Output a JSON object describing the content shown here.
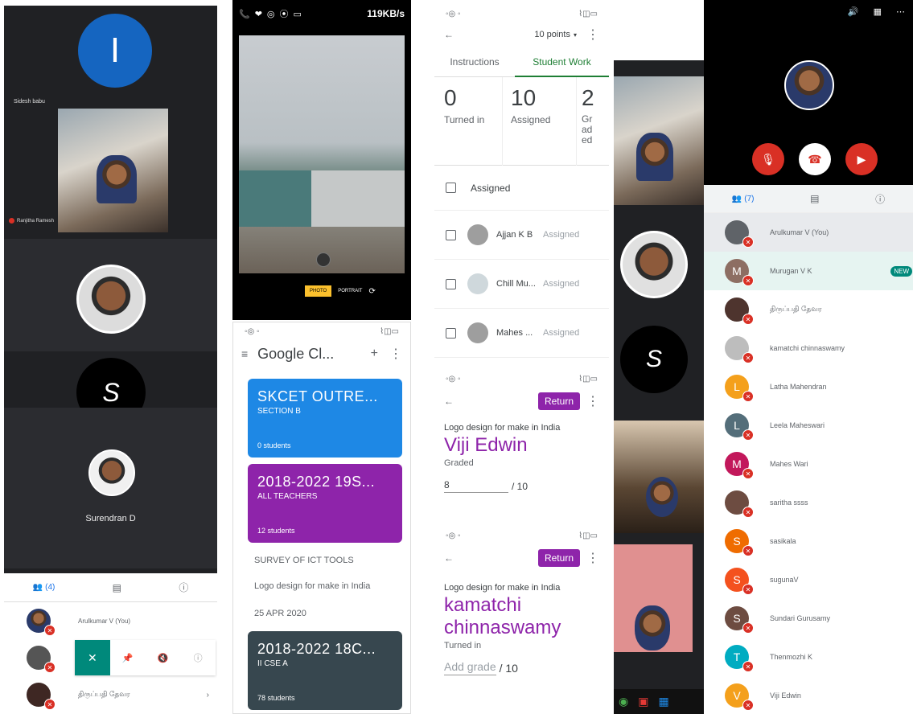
{
  "panel1": {
    "top_avatar_letter": "I",
    "caption_left": "Sidesh babu",
    "caption_small": "Ranjitha Ramesh",
    "tile_name": "Surendran D",
    "tabs": {
      "people_label": "(4)"
    },
    "participants": [
      {
        "name": "Arulkumar V (You)"
      },
      {
        "name": ""
      },
      {
        "name": "திருப்பதி தேவர"
      }
    ]
  },
  "panel2": {
    "status_right": "119KB/s",
    "camera_mode_photo": "PHOTO",
    "camera_mode_portrait": "PORTRAIT"
  },
  "panel3": {
    "points": "10 points",
    "tab_instructions": "Instructions",
    "tab_student_work": "Student Work",
    "stats": [
      {
        "num": "0",
        "label": "Turned in"
      },
      {
        "num": "10",
        "label": "Assigned"
      },
      {
        "num": "2",
        "label": "Gr ad ed"
      }
    ],
    "group_label": "Assigned",
    "students": [
      {
        "name": "Ajjan K B",
        "status": "Assigned"
      },
      {
        "name": "Chill Mu...",
        "status": "Assigned"
      },
      {
        "name": "Mahes ...",
        "status": "Assigned"
      }
    ]
  },
  "panel4": {
    "app_title": "Google Cl...",
    "cards": [
      {
        "title": "SKCET OUTRE...",
        "section": "SECTION B",
        "students": "0 students",
        "color": "#1e88e5"
      },
      {
        "title": "2018-2022 19S...",
        "section": "ALL TEACHERS",
        "students": "12 students",
        "color": "#8e24aa"
      },
      {
        "title": "2018-2022 18C...",
        "section": "II CSE A",
        "students": "78 students",
        "color": "#37474f"
      }
    ],
    "survey": "SURVEY OF ICT TOOLS",
    "logo_design": "Logo design for make in India",
    "date": "25 APR 2020"
  },
  "panel5": {
    "return_label": "Return",
    "assignment": "Logo design for make in India",
    "student_name": "Viji Edwin",
    "status": "Graded",
    "grade": "8",
    "out_of": "/ 10"
  },
  "panel6": {
    "return_label": "Return",
    "assignment": "Logo design for make in India",
    "student_name_line1": "kamatchi",
    "student_name_line2": "chinnaswamy",
    "status": "Turned in",
    "add_grade": "Add grade",
    "out_of": "/ 10"
  },
  "panel8": {
    "people_count": "(7)",
    "participants": [
      {
        "name": "Arulkumar V (You)",
        "letter": "",
        "color": "#5f6368"
      },
      {
        "name": "Murugan V K",
        "letter": "M",
        "color": "#8d6e63",
        "badge": "NEW"
      },
      {
        "name": "திருப்பதி தேவர",
        "letter": "",
        "color": "#4e342e"
      },
      {
        "name": "kamatchi chinnaswamy",
        "letter": "",
        "color": "#bdbdbd"
      },
      {
        "name": "Latha Mahendran",
        "letter": "L",
        "color": "#f4a01c"
      },
      {
        "name": "Leela Maheswari",
        "letter": "L",
        "color": "#546e7a"
      },
      {
        "name": "Mahes Wari",
        "letter": "M",
        "color": "#c2185b"
      },
      {
        "name": "saritha ssss",
        "letter": "",
        "color": "#6d4c41"
      },
      {
        "name": "sasikala",
        "letter": "S",
        "color": "#ef6c00"
      },
      {
        "name": "sugunaV",
        "letter": "S",
        "color": "#f4511e"
      },
      {
        "name": "Sundari Gurusamy",
        "letter": "S",
        "color": "#6d4c41"
      },
      {
        "name": "Thenmozhi K",
        "letter": "T",
        "color": "#00acc1"
      },
      {
        "name": "Viji Edwin",
        "letter": "V",
        "color": "#f4a01c"
      }
    ]
  }
}
